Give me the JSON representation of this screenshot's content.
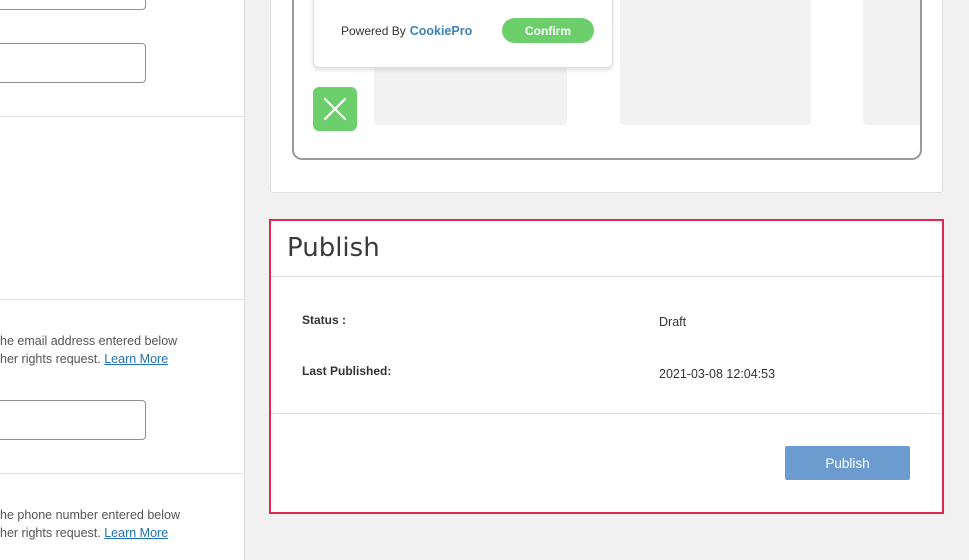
{
  "left_panel": {
    "email_help": {
      "line1": "he email address entered below",
      "line2": "her rights request.",
      "link": "Learn More"
    },
    "phone_help": {
      "line1": "he phone number entered below",
      "line2": "her rights request.",
      "link": "Learn More"
    }
  },
  "preview": {
    "powered_by": "Powered By",
    "brand": "CookiePro",
    "confirm_label": "Confirm",
    "close_icon": "close-x-icon"
  },
  "publish": {
    "title": "Publish",
    "status_label": "Status :",
    "status_value": "Draft",
    "last_published_label": "Last Published:",
    "last_published_value": "2021-03-08 12:04:53",
    "button_label": "Publish"
  },
  "colors": {
    "accent_green": "#6ccf6c",
    "publish_blue": "#6b9bcf",
    "highlight_red": "#e0284f",
    "link_blue": "#2271b1",
    "brand_blue": "#3b82b6"
  }
}
